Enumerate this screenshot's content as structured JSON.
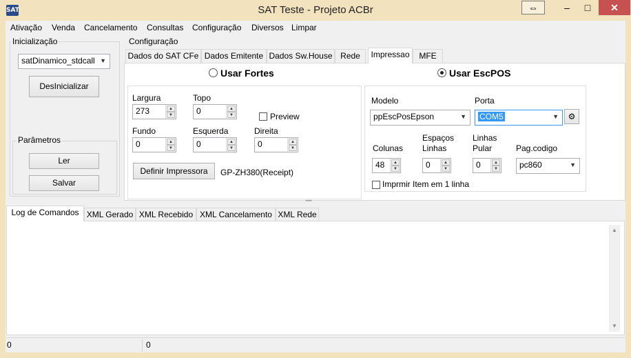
{
  "window": {
    "title": "SAT Teste - Projeto ACBr",
    "icon_text": "SAT",
    "restore_icon": "⇔",
    "min_icon": "–",
    "max_icon": "□",
    "close_icon": "✕"
  },
  "menu": [
    "Ativação",
    "Venda",
    "Cancelamento",
    "Consultas",
    "Configuração",
    "Diversos",
    "Limpar"
  ],
  "inicializacao": {
    "label": "Inicialização",
    "combo_value": "satDinamico_stdcall",
    "button": "DesInicializar"
  },
  "parametros": {
    "label": "Parâmetros",
    "ler": "Ler",
    "salvar": "Salvar"
  },
  "configuracao": {
    "label": "Configuração",
    "tabs": [
      "Dados do SAT CFe",
      "Dados Emitente",
      "Dados Sw.House",
      "Rede",
      "Impressao",
      "MFE"
    ],
    "active_tab": "Impressao"
  },
  "impressao": {
    "usar_fortes": "Usar Fortes",
    "usar_escpos": "Usar EscPOS",
    "fortes": {
      "largura_label": "Largura",
      "largura": "273",
      "topo_label": "Topo",
      "topo": "0",
      "preview_label": "Preview",
      "fundo_label": "Fundo",
      "fundo": "0",
      "esquerda_label": "Esquerda",
      "esquerda": "0",
      "direita_label": "Direita",
      "direita": "0",
      "definir_button": "Definir Impressora",
      "printer_name": "GP-ZH380(Receipt)"
    },
    "escpos": {
      "modelo_label": "Modelo",
      "modelo": "ppEscPosEpson",
      "porta_label": "Porta",
      "porta": "COM5",
      "colunas_label": "Colunas",
      "colunas": "48",
      "espacos_label_1": "Espaços",
      "espacos_label_2": "Linhas",
      "espacos": "0",
      "linhas_label_1": "Linhas",
      "linhas_label_2": "Pular",
      "linhas": "0",
      "pagcodigo_label": "Pag.codigo",
      "pagcodigo": "pc860",
      "imprimir_item_label": "Imprmir Item em 1 linha"
    }
  },
  "log": {
    "tabs": [
      "Log de Comandos",
      "XML Gerado",
      "XML Recebido",
      "XML Cancelamento",
      "XML Rede"
    ],
    "active_tab": "Log de Comandos"
  },
  "status": {
    "left": "0",
    "right": "0"
  },
  "icons": {
    "combo_arrow": "▼",
    "spin_up": "▲",
    "spin_down": "▼",
    "scroll_up": "▲",
    "scroll_down": "▼",
    "splitter": "••••••••",
    "port_config": "⚙"
  },
  "colors": {
    "titlebar": "#f2e2bd",
    "close": "#c75050",
    "selection": "#3399ff"
  }
}
